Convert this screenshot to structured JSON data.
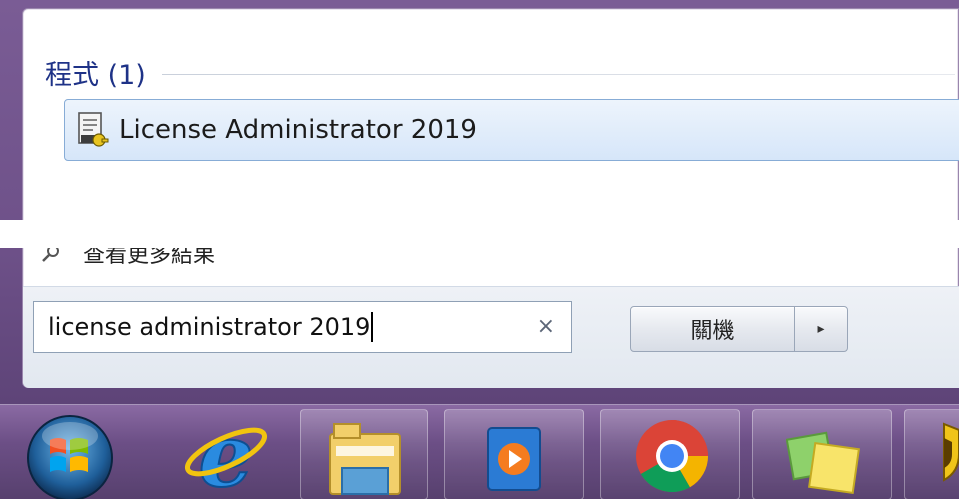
{
  "start_menu": {
    "section_title": "程式 (1)",
    "results": [
      {
        "label": "License Administrator 2019",
        "icon": "license-admin-icon"
      }
    ],
    "see_more_text": "查看更多結果"
  },
  "search": {
    "value": "license administrator 2019",
    "clear_glyph": "×"
  },
  "shutdown": {
    "label": "關機",
    "arrow_glyph": "▸"
  },
  "taskbar": {
    "items": [
      {
        "icon": "start-orb-icon"
      },
      {
        "icon": "internet-explorer-icon"
      },
      {
        "icon": "file-explorer-icon"
      },
      {
        "icon": "media-player-icon"
      },
      {
        "icon": "chrome-icon"
      },
      {
        "icon": "sticky-notes-icon"
      },
      {
        "icon": "shield-icon"
      }
    ]
  },
  "colors": {
    "section_title": "#1e3287",
    "selection_border": "#87acd6",
    "taskbar": "#6c4f86"
  }
}
